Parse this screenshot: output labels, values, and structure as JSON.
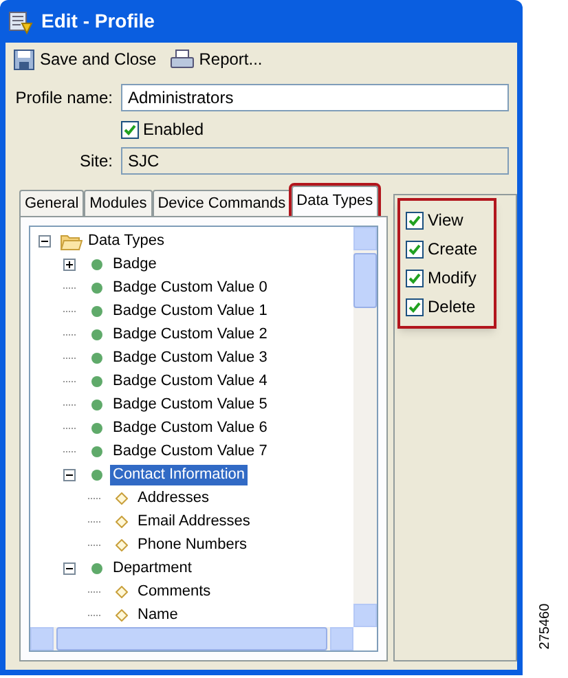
{
  "window": {
    "title": "Edit - Profile"
  },
  "toolbar": [
    {
      "label": "Save and Close",
      "kind": "save"
    },
    {
      "label": "Report...",
      "kind": "report"
    }
  ],
  "form": {
    "profile_name": {
      "label": "Profile name:",
      "value": "Administrators"
    },
    "enabled": {
      "label": "Enabled",
      "checked": true
    },
    "site": {
      "label": "Site:",
      "value": "SJC"
    }
  },
  "tabs": [
    {
      "label": "General",
      "selected": false,
      "highlighted": false
    },
    {
      "label": "Modules",
      "selected": false,
      "highlighted": false
    },
    {
      "label": "Device Commands",
      "selected": false,
      "highlighted": false
    },
    {
      "label": "Data Types",
      "selected": true,
      "highlighted": true
    }
  ],
  "tree": [
    {
      "label": "Data Types",
      "kind": "folder",
      "expanded": true,
      "selected": false,
      "children": [
        {
          "label": "Badge",
          "kind": "type",
          "expanded": false,
          "selected": false
        },
        {
          "label": "Badge Custom Value 0",
          "kind": "type",
          "selected": false
        },
        {
          "label": "Badge Custom Value 1",
          "kind": "type",
          "selected": false
        },
        {
          "label": "Badge Custom Value 2",
          "kind": "type",
          "selected": false
        },
        {
          "label": "Badge Custom Value 3",
          "kind": "type",
          "selected": false
        },
        {
          "label": "Badge Custom Value 4",
          "kind": "type",
          "selected": false
        },
        {
          "label": "Badge Custom Value 5",
          "kind": "type",
          "selected": false
        },
        {
          "label": "Badge Custom Value 6",
          "kind": "type",
          "selected": false
        },
        {
          "label": "Badge Custom Value 7",
          "kind": "type",
          "selected": false
        },
        {
          "label": "Contact Information",
          "kind": "type",
          "expanded": true,
          "selected": true,
          "children": [
            {
              "label": "Addresses",
              "kind": "field",
              "selected": false
            },
            {
              "label": "Email Addresses",
              "kind": "field",
              "selected": false
            },
            {
              "label": "Phone Numbers",
              "kind": "field",
              "selected": false
            }
          ]
        },
        {
          "label": "Department",
          "kind": "type",
          "expanded": true,
          "selected": false,
          "children": [
            {
              "label": "Comments",
              "kind": "field",
              "selected": false
            },
            {
              "label": "Name",
              "kind": "field",
              "selected": false
            }
          ]
        }
      ]
    }
  ],
  "permissions": {
    "highlighted": true,
    "items": [
      {
        "label": "View",
        "checked": true
      },
      {
        "label": "Create",
        "checked": true
      },
      {
        "label": "Modify",
        "checked": true
      },
      {
        "label": "Delete",
        "checked": true
      }
    ]
  },
  "figure_number": "275460"
}
